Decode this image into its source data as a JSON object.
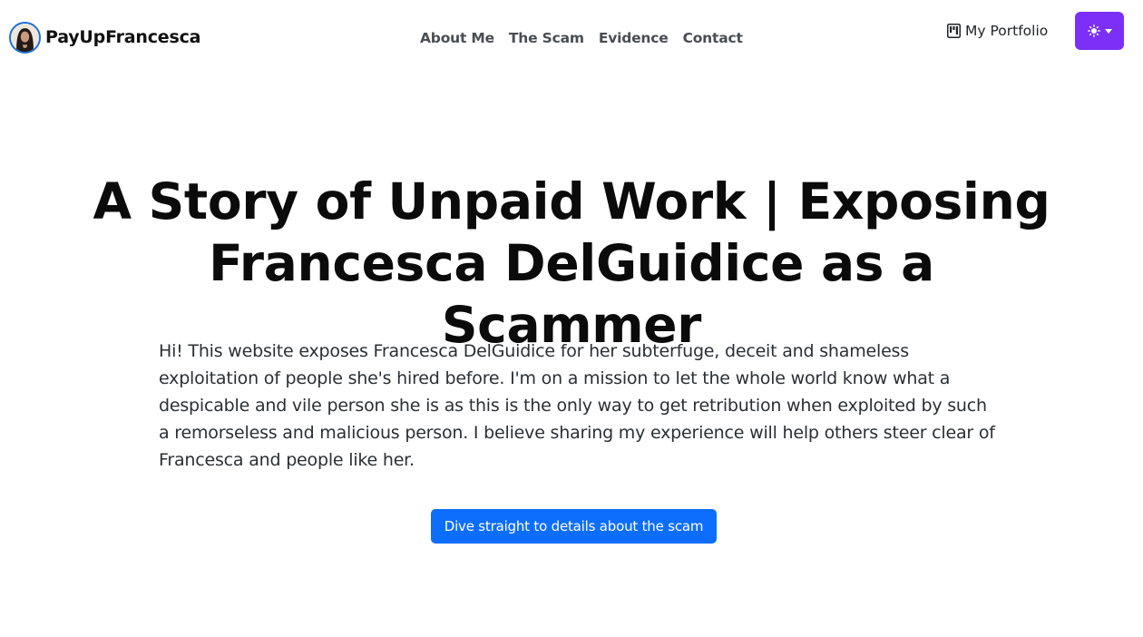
{
  "navbar": {
    "brand_name": "PayUpFrancesca",
    "links": [
      {
        "label": "About Me"
      },
      {
        "label": "The Scam"
      },
      {
        "label": "Evidence"
      },
      {
        "label": "Contact"
      }
    ],
    "portfolio_label": "My Portfolio",
    "portfolio_icon": "kanban-icon",
    "theme_toggle_icon": "sun-icon",
    "accent_color": "#7b2ff7"
  },
  "hero": {
    "title": "A Story of Unpaid Work | Exposing Francesca DelGuidice as a Scammer",
    "intro": "Hi! This website exposes Francesca DelGuidice for her subterfuge, deceit and shameless exploitation of people she's hired before. I'm on a mission to let the whole world know what a despicable and vile person she is as this is the only way to get retribution when exploited by such a remorseless and malicious person. I believe sharing my experience will help others steer clear of Francesca and people like her.",
    "cta_label": "Dive straight to details about the scam",
    "cta_color": "#0d6efd"
  }
}
